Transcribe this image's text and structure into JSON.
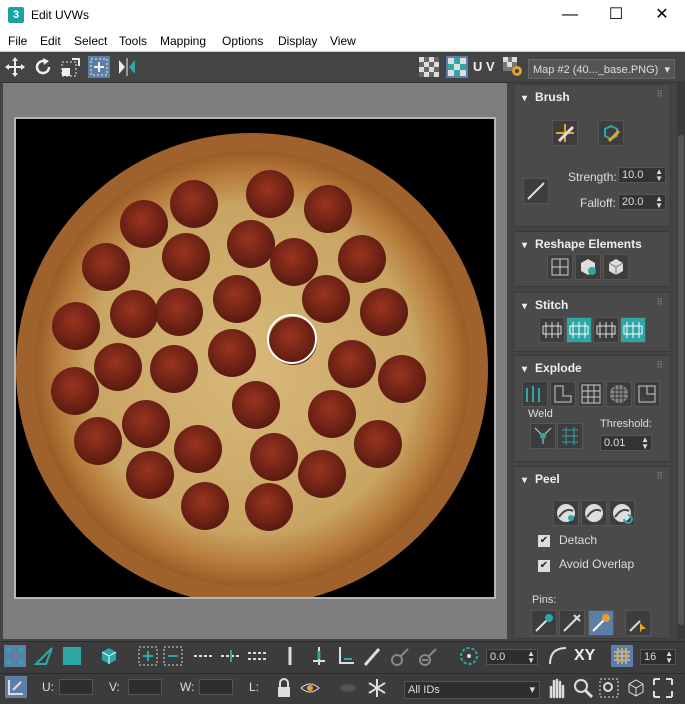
{
  "window": {
    "app_icon": "3",
    "title": "Edit UVWs",
    "minimize": "—",
    "maximize": "☐",
    "close": "✕"
  },
  "menu": [
    "File",
    "Edit",
    "Select",
    "Tools",
    "Mapping",
    "Options",
    "Display",
    "View"
  ],
  "toolbar": {
    "uv_label": "U V",
    "map_selector": "Map #2 (40..._base.PNG)",
    "map_arrow": "▾"
  },
  "rollouts": {
    "brush": {
      "title": "Brush",
      "strength_label": "Strength:",
      "strength_value": "10.0",
      "falloff_label": "Falloff:",
      "falloff_value": "20.0"
    },
    "reshape": {
      "title": "Reshape Elements"
    },
    "stitch": {
      "title": "Stitch"
    },
    "explode": {
      "title": "Explode",
      "weld_label": "Weld",
      "threshold_label": "Threshold:",
      "threshold_value": "0.01"
    },
    "peel": {
      "title": "Peel",
      "detach_label": "Detach",
      "avoid_overlap_label": "Avoid Overlap",
      "pins_label": "Pins:",
      "check": "✔"
    }
  },
  "bottom_bar": {
    "rotate_value": "0.0",
    "xy_label": "XY",
    "grid_value": "16"
  },
  "status_bar": {
    "u_label": "U:",
    "v_label": "V:",
    "w_label": "W:",
    "l_label": "L:",
    "ids_value": "All IDs",
    "ids_arrow": "▾"
  },
  "colors": {
    "accent_teal": "#2fa7a7",
    "selection_blue": "#5b7fa6",
    "panel_bg": "#444444"
  },
  "icons": [
    "move-icon",
    "rotate-icon",
    "scale-icon",
    "freeform-icon",
    "mirror-icon",
    "checker-icon",
    "pan-icon",
    "zoom-icon"
  ]
}
